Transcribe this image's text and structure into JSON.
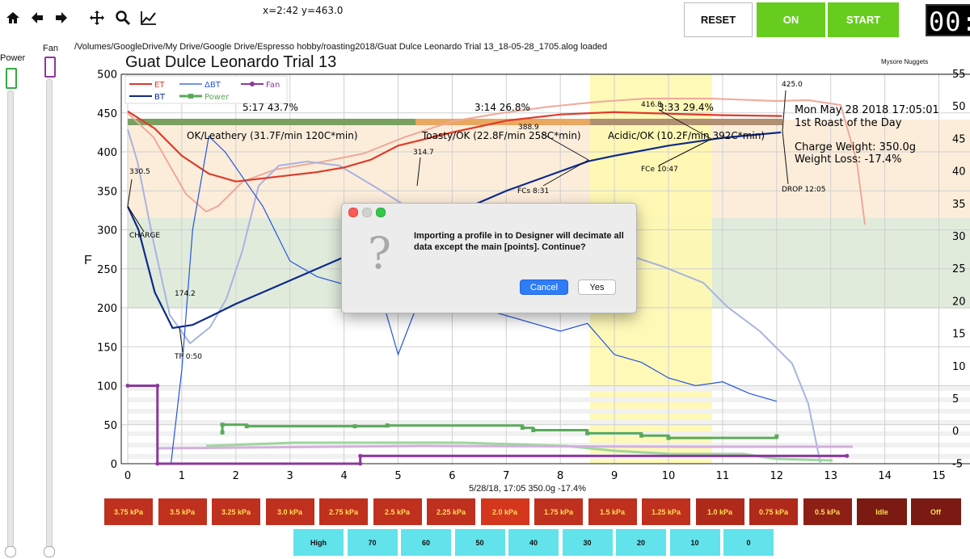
{
  "toolbar": {
    "icons": [
      "home-icon",
      "arrow-left-icon",
      "arrow-right-icon",
      "move-icon",
      "zoom-icon",
      "chart-line-icon"
    ],
    "coords": "x=2:42 y=463.0",
    "reset_label": "RESET",
    "on_label": "ON",
    "start_label": "START",
    "timer": "00:"
  },
  "side": {
    "power_label": "Power",
    "fan_label": "Fan",
    "power_color": "#33aa44",
    "fan_color": "#8a3a9a"
  },
  "filepath": "/Volumes/GoogleDrive/My Drive/Google Drive/Espresso hobby/roasting2018/Guat Dulce Leonardo Trial 13_18-05-28_1705.alog  loaded",
  "chart": {
    "title": "Guat Dulce Leonardo Trial 13",
    "subtitle": "Mysore Nuggets",
    "ylabel": "F",
    "date_line": "5/28/18, 17:05   350.0g   -17.4%",
    "info_date": "Mon May 28 2018 17:05:01",
    "info_roast": "1st Roast of the Day",
    "info_charge": "Charge Weight: 350.0g",
    "info_loss": "Weight Loss: -17.4%",
    "phase_dry": "5:17  43.7%",
    "phase_mid": "3:14  26.8%",
    "phase_dev": "3:33  29.4%",
    "phase_dry_label": "OK/Leathery (31.7F/min  120C*min)",
    "phase_mid_label": "Toasty/OK (22.8F/min  258C*min)",
    "phase_dev_label": "Acidic/OK (10.2F/min  392C*min)",
    "legend": [
      {
        "name": "ET",
        "color": "#e03a2a"
      },
      {
        "name": "BT",
        "color": "#0d2a8a"
      },
      {
        "name": "ΔBT",
        "color": "#2255dd"
      },
      {
        "name": "Power",
        "color": "#5aaa5a"
      },
      {
        "name": "Fan",
        "color": "#8a3a9a"
      }
    ],
    "annotations": {
      "charge": "CHARGE",
      "charge_val": "330.5",
      "tp": "TP 0:50",
      "tp_val": "174.2",
      "val_314": "314.7",
      "val_388": "388.9",
      "fcs": "FCs 8:31",
      "val_416": "416.8",
      "fce": "FCe 10:47",
      "val_425": "425.0",
      "drop": "DROP 12:05"
    },
    "colors": {
      "ET": "#e03a2a",
      "BT": "#0d2a8a",
      "dBT": "#2255dd",
      "Power": "#5aaa5a",
      "Fan": "#8a3a9a",
      "dry_band": "#7aa060",
      "mid_band": "#e8a860",
      "dev_band": "#b09070",
      "yellow_band": "#fff8b0"
    }
  },
  "chart_data": {
    "type": "line",
    "xlabel": "",
    "ylabel": "F",
    "xlim": [
      0,
      15
    ],
    "ylim": [
      0,
      500
    ],
    "x_ticks": [
      0,
      1,
      2,
      3,
      4,
      5,
      6,
      7,
      8,
      9,
      10,
      11,
      12,
      13,
      14,
      15
    ],
    "y_ticks": [
      0,
      50,
      100,
      150,
      200,
      250,
      300,
      350,
      400,
      450,
      500
    ],
    "y2_ticks": [
      "55",
      "50",
      "45",
      "40",
      "35",
      "30",
      "25",
      "20",
      "15",
      "10",
      "5",
      "0",
      "-5"
    ],
    "series": [
      {
        "name": "ET",
        "x": [
          0,
          0.5,
          1,
          1.5,
          2,
          2.5,
          3,
          3.5,
          4,
          4.5,
          5,
          6,
          7,
          8,
          9,
          10,
          11,
          12.1
        ],
        "y": [
          452,
          430,
          395,
          372,
          362,
          366,
          370,
          374,
          380,
          390,
          408,
          425,
          440,
          448,
          451,
          449,
          447,
          446
        ]
      },
      {
        "name": "BT",
        "x": [
          0,
          0.2,
          0.5,
          0.83,
          1.2,
          1.5,
          2,
          2.5,
          3,
          3.5,
          4,
          4.5,
          5,
          5.5,
          6,
          7,
          8,
          8.52,
          9,
          10,
          11,
          12.08
        ],
        "y": [
          330,
          300,
          220,
          174,
          178,
          188,
          205,
          220,
          235,
          250,
          265,
          278,
          292,
          305,
          320,
          350,
          375,
          388,
          395,
          408,
          418,
          425
        ]
      },
      {
        "name": "ΔBT",
        "x": [
          0.8,
          1.0,
          1.2,
          1.5,
          1.8,
          2.0,
          2.5,
          3,
          3.5,
          4,
          4.5,
          5,
          5.5,
          6,
          7,
          8,
          8.5,
          9,
          9.5,
          10,
          10.5,
          11,
          11.5,
          12
        ],
        "y": [
          0,
          120,
          300,
          420,
          400,
          380,
          330,
          260,
          240,
          230,
          260,
          140,
          230,
          210,
          190,
          170,
          180,
          140,
          130,
          110,
          100,
          105,
          90,
          80
        ]
      },
      {
        "name": "Power",
        "x": [
          1.75,
          1.75,
          2.2,
          4.2,
          4.8,
          7.3,
          7.5,
          8.5,
          9.5,
          10,
          12
        ],
        "y": [
          40,
          50,
          48,
          48,
          49,
          46,
          43,
          39,
          36,
          33,
          35
        ]
      },
      {
        "name": "Fan",
        "x": [
          0,
          0.55,
          0.55,
          4.3,
          4.3,
          13.3
        ],
        "y": [
          100,
          100,
          0,
          0,
          10,
          10
        ]
      }
    ]
  },
  "power_buttons": [
    "3.75 kPa",
    "3.5 kPa",
    "3.25 kPa",
    "3.0 kPa",
    "2.75 kPa",
    "2.5 kPa",
    "2.25 kPa",
    "2.0 kPa",
    "1.75 kPa",
    "1.5 kPa",
    "1.25 kPa",
    "1.0 kPa",
    "0.75 kPa",
    "0.5 kPa",
    "Idle",
    "Off"
  ],
  "fan_buttons": [
    "High",
    "70",
    "60",
    "50",
    "40",
    "30",
    "20",
    "10",
    "0"
  ],
  "dialog": {
    "message": "Importing a profile in to Designer will decimate all data except the main [points]. Continue?",
    "icon": "question-icon",
    "cancel_label": "Cancel",
    "yes_label": "Yes"
  }
}
